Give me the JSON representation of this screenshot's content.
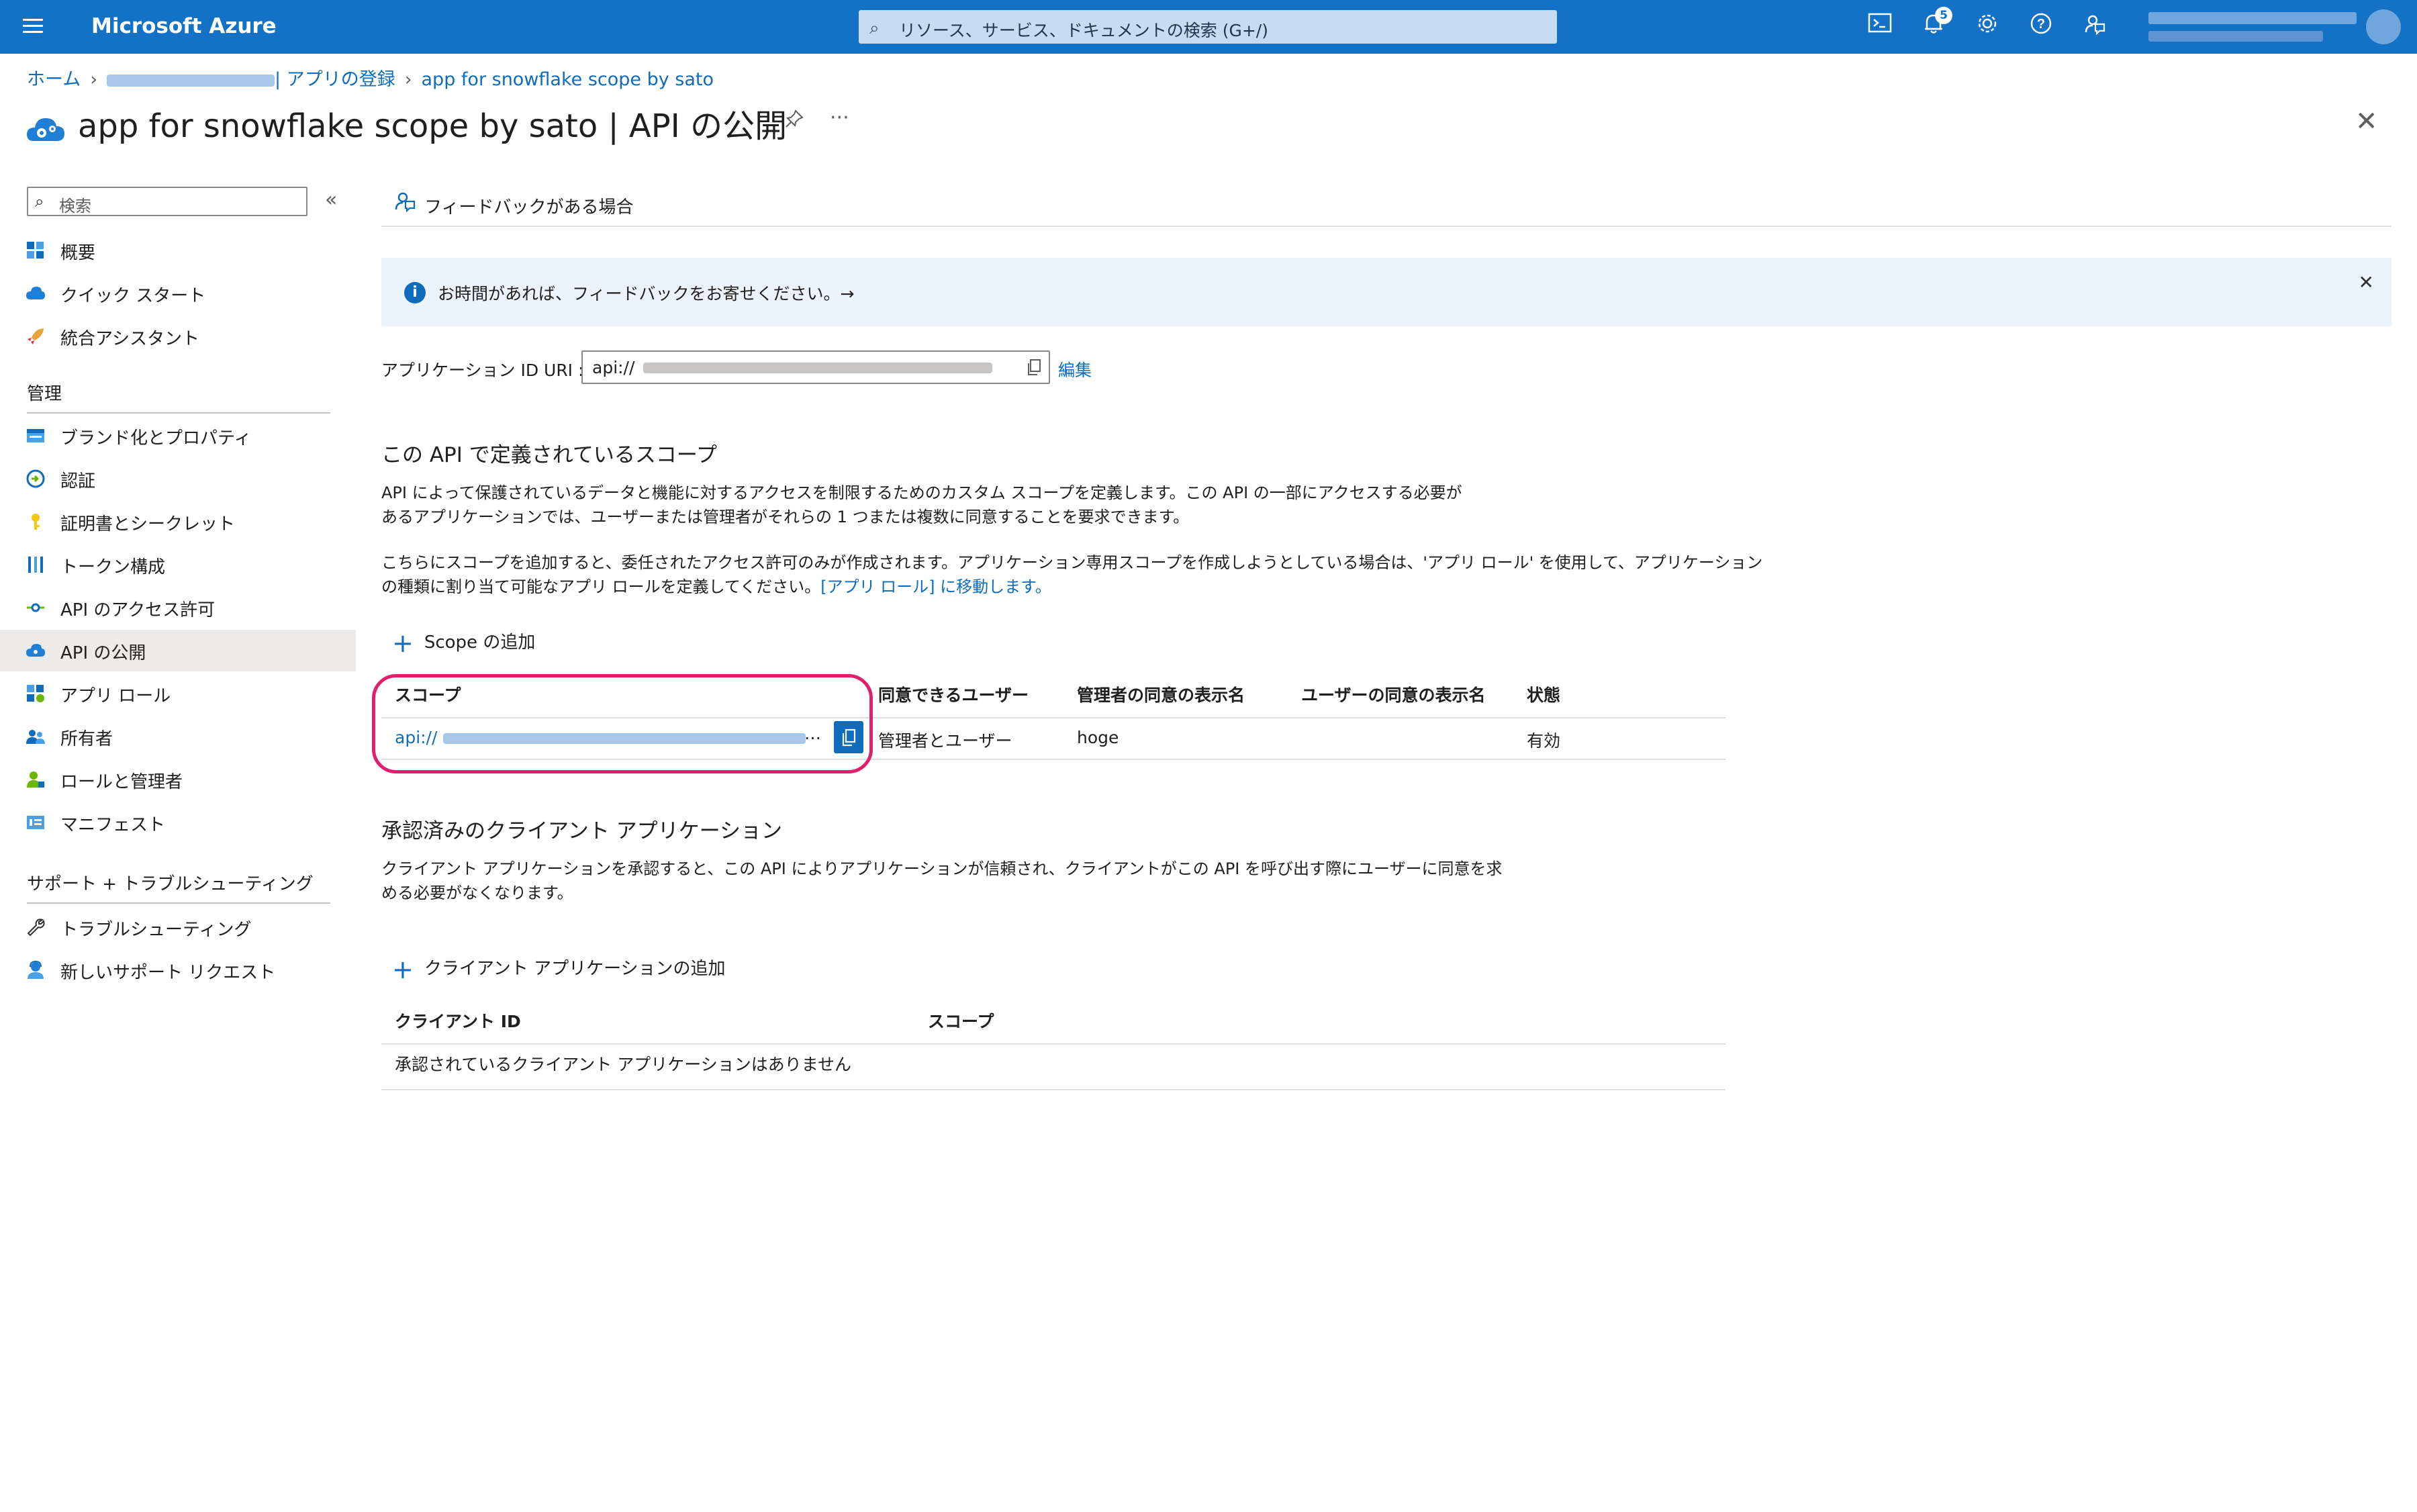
{
  "topbar": {
    "brand": "Microsoft Azure",
    "search_placeholder": "リソース、サービス、ドキュメントの検索 (G+/)",
    "notification_count": "5",
    "accent_color": "#1371c6"
  },
  "breadcrumb": {
    "home": "ホーム",
    "app_registrations": "| アプリの登録",
    "current": "app for snowflake scope by sato"
  },
  "title": {
    "text": "app for snowflake scope by sato | API の公開"
  },
  "sidebar": {
    "search_placeholder": "検索",
    "collapse": "«",
    "items_top": [
      {
        "label": "概要",
        "icon": "grid-icon"
      },
      {
        "label": "クイック スタート",
        "icon": "cloud-icon"
      },
      {
        "label": "統合アシスタント",
        "icon": "rocket-icon"
      }
    ],
    "section_manage": "管理",
    "items_manage": [
      {
        "label": "ブランド化とプロパティ",
        "icon": "branding-icon"
      },
      {
        "label": "認証",
        "icon": "auth-icon"
      },
      {
        "label": "証明書とシークレット",
        "icon": "key-icon"
      },
      {
        "label": "トークン構成",
        "icon": "token-icon"
      },
      {
        "label": "API のアクセス許可",
        "icon": "permission-icon"
      },
      {
        "label": "API の公開",
        "icon": "expose-api-icon",
        "active": true
      },
      {
        "label": "アプリ ロール",
        "icon": "app-roles-icon"
      },
      {
        "label": "所有者",
        "icon": "owners-icon"
      },
      {
        "label": "ロールと管理者",
        "icon": "roles-admin-icon"
      },
      {
        "label": "マニフェスト",
        "icon": "manifest-icon"
      }
    ],
    "section_support": "サポート + トラブルシューティング",
    "items_support": [
      {
        "label": "トラブルシューティング",
        "icon": "wrench-icon"
      },
      {
        "label": "新しいサポート リクエスト",
        "icon": "support-icon"
      }
    ]
  },
  "main": {
    "feedback_label": "フィードバックがある場合",
    "info_banner": "お時間があれば、フィードバックをお寄せください。→",
    "app_id_uri_label": "アプリケーション ID URI :",
    "app_id_uri_value": "api://",
    "edit_link": "編集",
    "scopes_heading": "この API で定義されているスコープ",
    "scopes_desc_1": "API によって保護されているデータと機能に対するアクセスを制限するためのカスタム スコープを定義します。この API の一部にアクセスする必要が",
    "scopes_desc_2": "あるアプリケーションでは、ユーザーまたは管理者がそれらの 1 つまたは複数に同意することを要求できます。",
    "scopes_desc_3": "こちらにスコープを追加すると、委任されたアクセス許可のみが作成されます。アプリケーション専用スコープを作成しようとしている場合は、'アプリ ロール' を使用して、アプリケーション",
    "scopes_desc_4": "の種類に割り当て可能なアプリ ロールを定義してください。",
    "app_roles_link": "[アプリ ロール] に移動します。",
    "add_scope": "Scope の追加",
    "scope_columns": [
      "スコープ",
      "同意できるユーザー",
      "管理者の同意の表示名",
      "ユーザーの同意の表示名",
      "状態"
    ],
    "scope_rows": [
      {
        "scope": "api://",
        "who_can_consent": "管理者とユーザー",
        "admin_display": "hoge",
        "user_display": "",
        "state": "有効"
      }
    ],
    "scope_ellipsis": "…",
    "client_heading": "承認済みのクライアント アプリケーション",
    "client_desc_1": "クライアント アプリケーションを承認すると、この API によりアプリケーションが信頼され、クライアントがこの API を呼び出す際にユーザーに同意を求",
    "client_desc_2": "める必要がなくなります。",
    "add_client": "クライアント アプリケーションの追加",
    "client_columns": [
      "クライアント ID",
      "スコープ"
    ],
    "client_empty": "承認されているクライアント アプリケーションはありません"
  }
}
